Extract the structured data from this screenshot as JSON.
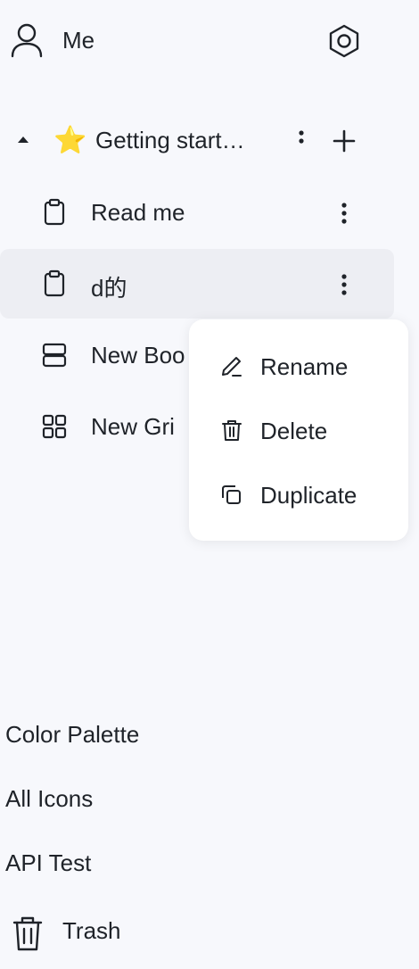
{
  "user": {
    "name": "Me",
    "icon": "user-icon"
  },
  "settings": {
    "icon": "settings-icon"
  },
  "space": {
    "emoji": "⭐",
    "title": "Getting start…"
  },
  "pages": [
    {
      "label": "Read me",
      "icon": "document-icon"
    },
    {
      "label": "d的",
      "icon": "document-icon"
    },
    {
      "label": "New Boo",
      "icon": "board-icon"
    },
    {
      "label": "New Gri",
      "icon": "grid-icon"
    }
  ],
  "context_menu": {
    "items": [
      {
        "label": "Rename",
        "icon": "pencil-icon"
      },
      {
        "label": "Delete",
        "icon": "trash-icon"
      },
      {
        "label": "Duplicate",
        "icon": "duplicate-icon"
      }
    ]
  },
  "bottom_links": [
    "Color Palette",
    "All Icons",
    "API Test"
  ],
  "trash": {
    "label": "Trash"
  },
  "colors": {
    "background": "#f7f8fc",
    "selected_row": "#edeef3",
    "menu_bg": "#ffffff",
    "text": "#1f2329"
  }
}
